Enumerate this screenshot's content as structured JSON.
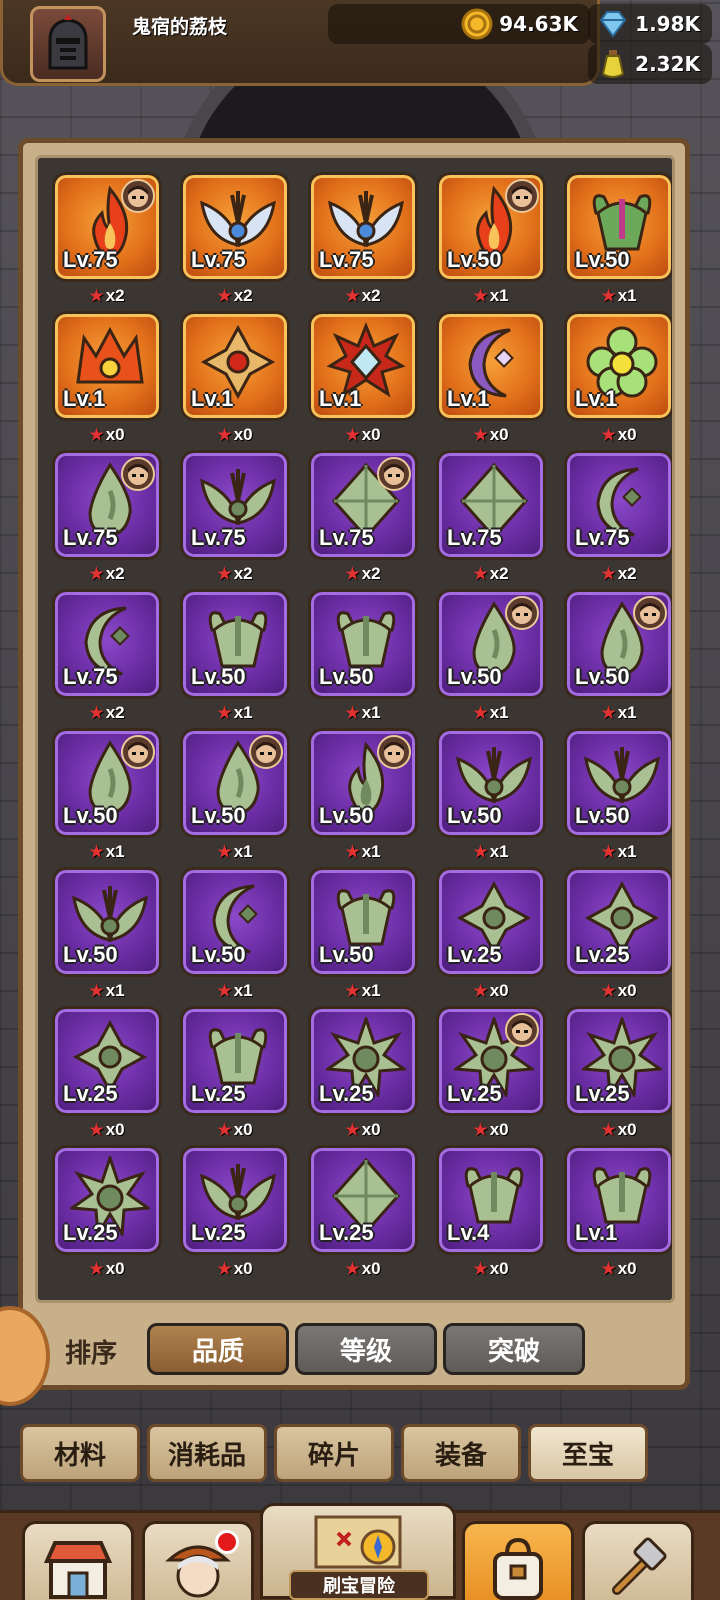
{
  "header": {
    "player_name": "鬼宿的荔枝",
    "gold": "94.63K",
    "diamonds": "1.98K",
    "potions": "2.32K"
  },
  "items": [
    {
      "rarity": "gold",
      "icon": "flame-relic-icon",
      "level": "Lv.75",
      "stars": "x2",
      "badge": true
    },
    {
      "rarity": "gold",
      "icon": "wing-crest-icon",
      "level": "Lv.75",
      "stars": "x2",
      "badge": false
    },
    {
      "rarity": "gold",
      "icon": "wing-crest-icon",
      "level": "Lv.75",
      "stars": "x2",
      "badge": false
    },
    {
      "rarity": "gold",
      "icon": "flame-relic-icon",
      "level": "Lv.50",
      "stars": "x1",
      "badge": true
    },
    {
      "rarity": "gold",
      "icon": "horned-helm-icon",
      "level": "Lv.50",
      "stars": "x1",
      "badge": false
    },
    {
      "rarity": "gold",
      "icon": "demon-crown-icon",
      "level": "Lv.1",
      "stars": "x0",
      "badge": false
    },
    {
      "rarity": "gold",
      "icon": "jewel-cross-icon",
      "level": "Lv.1",
      "stars": "x0",
      "badge": false
    },
    {
      "rarity": "gold",
      "icon": "star-gem-icon",
      "level": "Lv.1",
      "stars": "x0",
      "badge": false
    },
    {
      "rarity": "gold",
      "icon": "crescent-moon-icon",
      "level": "Lv.1",
      "stars": "x0",
      "badge": false
    },
    {
      "rarity": "gold",
      "icon": "flower-icon",
      "level": "Lv.1",
      "stars": "x0",
      "badge": false
    },
    {
      "rarity": "purple",
      "icon": "droplet-relic-icon",
      "level": "Lv.75",
      "stars": "x2",
      "badge": true
    },
    {
      "rarity": "purple",
      "icon": "wing-crest-icon",
      "level": "Lv.75",
      "stars": "x2",
      "badge": false
    },
    {
      "rarity": "purple",
      "icon": "diamond-gem-icon",
      "level": "Lv.75",
      "stars": "x2",
      "badge": true
    },
    {
      "rarity": "purple",
      "icon": "diamond-gem-icon",
      "level": "Lv.75",
      "stars": "x2",
      "badge": false
    },
    {
      "rarity": "purple",
      "icon": "crescent-moon-icon",
      "level": "Lv.75",
      "stars": "x2",
      "badge": false
    },
    {
      "rarity": "purple",
      "icon": "crescent-moon-icon",
      "level": "Lv.75",
      "stars": "x2",
      "badge": false
    },
    {
      "rarity": "purple",
      "icon": "horned-helm-icon",
      "level": "Lv.50",
      "stars": "x1",
      "badge": false
    },
    {
      "rarity": "purple",
      "icon": "horned-helm-icon",
      "level": "Lv.50",
      "stars": "x1",
      "badge": false
    },
    {
      "rarity": "purple",
      "icon": "droplet-relic-icon",
      "level": "Lv.50",
      "stars": "x1",
      "badge": true
    },
    {
      "rarity": "purple",
      "icon": "droplet-relic-icon",
      "level": "Lv.50",
      "stars": "x1",
      "badge": true
    },
    {
      "rarity": "purple",
      "icon": "droplet-relic-icon",
      "level": "Lv.50",
      "stars": "x1",
      "badge": true
    },
    {
      "rarity": "purple",
      "icon": "droplet-relic-icon",
      "level": "Lv.50",
      "stars": "x1",
      "badge": true
    },
    {
      "rarity": "purple",
      "icon": "flame-relic-icon",
      "level": "Lv.50",
      "stars": "x1",
      "badge": true
    },
    {
      "rarity": "purple",
      "icon": "wing-crest-icon",
      "level": "Lv.50",
      "stars": "x1",
      "badge": false
    },
    {
      "rarity": "purple",
      "icon": "wing-crest-icon",
      "level": "Lv.50",
      "stars": "x1",
      "badge": false
    },
    {
      "rarity": "purple",
      "icon": "wing-crest-icon",
      "level": "Lv.50",
      "stars": "x1",
      "badge": false
    },
    {
      "rarity": "purple",
      "icon": "crescent-moon-icon",
      "level": "Lv.50",
      "stars": "x1",
      "badge": false
    },
    {
      "rarity": "purple",
      "icon": "horned-helm-icon",
      "level": "Lv.50",
      "stars": "x1",
      "badge": false
    },
    {
      "rarity": "purple",
      "icon": "jewel-cross-icon",
      "level": "Lv.25",
      "stars": "x0",
      "badge": false
    },
    {
      "rarity": "purple",
      "icon": "jewel-cross-icon",
      "level": "Lv.25",
      "stars": "x0",
      "badge": false
    },
    {
      "rarity": "purple",
      "icon": "jewel-cross-icon",
      "level": "Lv.25",
      "stars": "x0",
      "badge": false
    },
    {
      "rarity": "purple",
      "icon": "horned-helm-icon",
      "level": "Lv.25",
      "stars": "x0",
      "badge": false
    },
    {
      "rarity": "purple",
      "icon": "spiked-star-icon",
      "level": "Lv.25",
      "stars": "x0",
      "badge": false
    },
    {
      "rarity": "purple",
      "icon": "spiked-star-icon",
      "level": "Lv.25",
      "stars": "x0",
      "badge": true
    },
    {
      "rarity": "purple",
      "icon": "spiked-star-icon",
      "level": "Lv.25",
      "stars": "x0",
      "badge": false
    },
    {
      "rarity": "purple",
      "icon": "spiked-star-icon",
      "level": "Lv.25",
      "stars": "x0",
      "badge": false
    },
    {
      "rarity": "purple",
      "icon": "wing-crest-icon",
      "level": "Lv.25",
      "stars": "x0",
      "badge": false
    },
    {
      "rarity": "purple",
      "icon": "diamond-gem-icon",
      "level": "Lv.25",
      "stars": "x0",
      "badge": false
    },
    {
      "rarity": "purple",
      "icon": "horned-helm-icon",
      "level": "Lv.4",
      "stars": "x0",
      "badge": false
    },
    {
      "rarity": "purple",
      "icon": "horned-helm-icon",
      "level": "Lv.1",
      "stars": "x0",
      "badge": false
    }
  ],
  "sort": {
    "label": "排序",
    "options": [
      "品质",
      "等级",
      "突破"
    ],
    "active": 0
  },
  "tabs": {
    "labels": [
      "材料",
      "消耗品",
      "碎片",
      "装备",
      "至宝"
    ],
    "selected": 4
  },
  "nav": {
    "center_label": "刷宝冒险",
    "items": [
      "shop-icon",
      "hero-icon",
      "treasure-map-icon",
      "backpack-icon",
      "forge-icon"
    ],
    "active": 3
  },
  "colors": {
    "gold_card": "#e2701a",
    "purple_card": "#6a2ca3",
    "star": "#e23232",
    "panel": "#c8b08a"
  }
}
